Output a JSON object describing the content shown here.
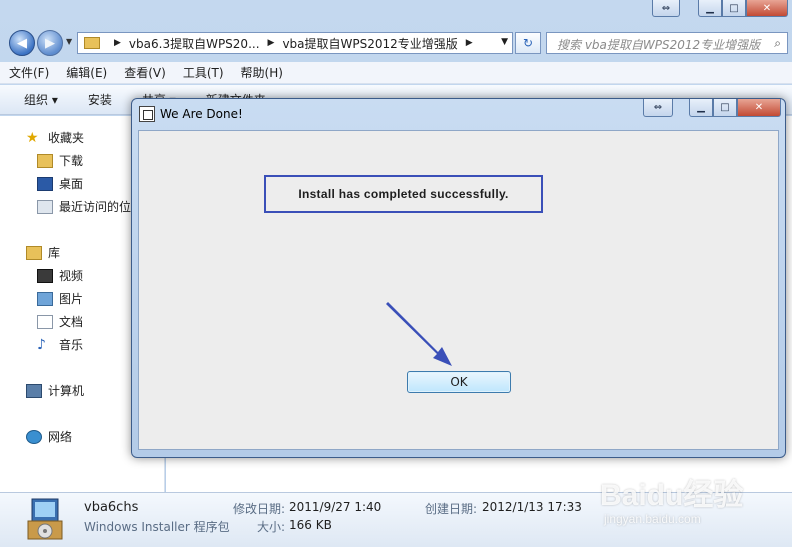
{
  "explorer": {
    "address": {
      "segments": [
        "vba6.3提取自WPS20...",
        "vba提取自WPS2012专业增强版"
      ]
    },
    "search": {
      "placeholder": "搜索 vba提取自WPS2012专业增强版"
    },
    "menu": [
      "文件(F)",
      "编辑(E)",
      "查看(V)",
      "工具(T)",
      "帮助(H)"
    ],
    "toolbar": [
      "组织 ▾",
      "安装",
      "共享 ▾",
      "新建文件夹"
    ],
    "nav": {
      "favorites": "收藏夹",
      "downloads": "下载",
      "desktop": "桌面",
      "recent": "最近访问的位置",
      "libraries": "库",
      "videos": "视频",
      "pictures": "图片",
      "documents": "文档",
      "music": "音乐",
      "computer": "计算机",
      "network": "网络"
    },
    "details": {
      "filename": "vba6chs",
      "filetype": "Windows Installer 程序包",
      "modified_label": "修改日期:",
      "modified_value": "2011/9/27 1:40",
      "created_label": "创建日期:",
      "created_value": "2012/1/13 17:33",
      "size_label": "大小:",
      "size_value": "166 KB"
    }
  },
  "dialog": {
    "title": "We Are Done!",
    "message": "Install has completed successfully.",
    "ok_label": "OK"
  },
  "watermark": {
    "brand": "Baidu经验",
    "url": "jingyan.baidu.com"
  },
  "colors": {
    "message_border": "#3a4fb8",
    "arrow": "#3a4fb8",
    "close_button": "#c24a34"
  }
}
